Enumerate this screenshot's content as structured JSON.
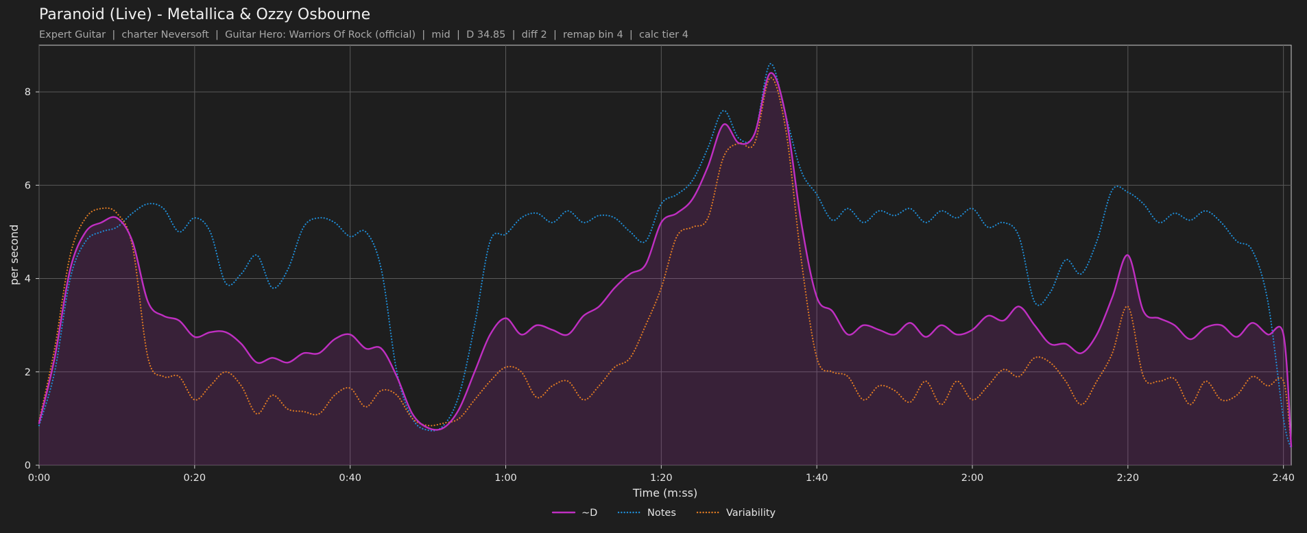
{
  "chart_data": {
    "type": "line",
    "title": "Paranoid (Live) - Metallica & Ozzy Osbourne",
    "subtitle": "Expert Guitar  |  charter Neversoft  |  Guitar Hero: Warriors Of Rock (official)  |  mid  |  D 34.85  |  diff 2  |  remap bin 4  |  calc tier 4",
    "xlabel": "Time (m:ss)",
    "ylabel": "per second",
    "xlim": [
      0,
      161
    ],
    "ylim": [
      0,
      9
    ],
    "grid": true,
    "legend_position": "bottom-center",
    "x_ticks": [
      0,
      20,
      40,
      60,
      80,
      100,
      120,
      140,
      160
    ],
    "x_tick_labels": [
      "0:00",
      "0:20",
      "0:40",
      "1:00",
      "1:20",
      "1:40",
      "2:00",
      "2:20",
      "2:40"
    ],
    "y_ticks": [
      0,
      2,
      4,
      6,
      8
    ],
    "y_tick_labels": [
      "0",
      "2",
      "4",
      "6",
      "8"
    ],
    "x": [
      0,
      2,
      4,
      6,
      8,
      10,
      12,
      14,
      16,
      18,
      20,
      22,
      24,
      26,
      28,
      30,
      32,
      34,
      36,
      38,
      40,
      42,
      44,
      46,
      48,
      50,
      52,
      54,
      56,
      58,
      60,
      62,
      64,
      66,
      68,
      70,
      72,
      74,
      76,
      78,
      80,
      82,
      84,
      86,
      88,
      90,
      92,
      94,
      96,
      98,
      100,
      102,
      104,
      106,
      108,
      110,
      112,
      114,
      116,
      118,
      120,
      122,
      124,
      126,
      128,
      130,
      132,
      134,
      136,
      138,
      140,
      142,
      144,
      146,
      148,
      150,
      152,
      154,
      156,
      158,
      160,
      161
    ],
    "series": [
      {
        "name": "~D",
        "color": "#c02fc2",
        "style": "solid",
        "fill": true,
        "values": [
          0.9,
          2.3,
          4.2,
          5.0,
          5.2,
          5.3,
          4.8,
          3.5,
          3.2,
          3.1,
          2.75,
          2.85,
          2.85,
          2.6,
          2.2,
          2.3,
          2.2,
          2.4,
          2.4,
          2.7,
          2.8,
          2.5,
          2.5,
          1.9,
          1.1,
          0.8,
          0.8,
          1.2,
          2.0,
          2.8,
          3.15,
          2.8,
          3.0,
          2.9,
          2.8,
          3.2,
          3.4,
          3.8,
          4.1,
          4.3,
          5.2,
          5.4,
          5.7,
          6.4,
          7.3,
          6.9,
          7.1,
          8.4,
          7.5,
          5.2,
          3.6,
          3.3,
          2.8,
          3.0,
          2.9,
          2.8,
          3.05,
          2.75,
          3.0,
          2.8,
          2.9,
          3.2,
          3.1,
          3.4,
          3.0,
          2.6,
          2.6,
          2.4,
          2.8,
          3.6,
          4.5,
          3.3,
          3.15,
          3.0,
          2.7,
          2.95,
          3.0,
          2.75,
          3.05,
          2.8,
          2.8,
          0.4
        ]
      },
      {
        "name": "Notes",
        "color": "#1f8dd6",
        "style": "dotted",
        "fill": false,
        "values": [
          0.85,
          2.0,
          4.0,
          4.8,
          5.0,
          5.1,
          5.4,
          5.6,
          5.5,
          5.0,
          5.3,
          5.0,
          3.9,
          4.1,
          4.5,
          3.8,
          4.2,
          5.1,
          5.3,
          5.2,
          4.9,
          5.0,
          4.2,
          2.0,
          1.0,
          0.75,
          0.85,
          1.5,
          3.0,
          4.8,
          4.95,
          5.3,
          5.4,
          5.2,
          5.45,
          5.2,
          5.35,
          5.3,
          5.0,
          4.8,
          5.6,
          5.8,
          6.1,
          6.8,
          7.6,
          7.0,
          7.1,
          8.6,
          7.5,
          6.3,
          5.8,
          5.25,
          5.5,
          5.2,
          5.45,
          5.35,
          5.5,
          5.2,
          5.45,
          5.3,
          5.5,
          5.1,
          5.2,
          4.9,
          3.5,
          3.7,
          4.4,
          4.1,
          4.8,
          5.9,
          5.85,
          5.6,
          5.2,
          5.4,
          5.25,
          5.45,
          5.2,
          4.8,
          4.6,
          3.5,
          1.0,
          0.35
        ]
      },
      {
        "name": "Variability",
        "color": "#e07b23",
        "style": "dotted",
        "fill": false,
        "values": [
          0.95,
          2.5,
          4.5,
          5.3,
          5.5,
          5.4,
          4.7,
          2.3,
          1.9,
          1.9,
          1.4,
          1.7,
          2.0,
          1.7,
          1.1,
          1.5,
          1.2,
          1.15,
          1.1,
          1.5,
          1.65,
          1.25,
          1.6,
          1.5,
          1.0,
          0.85,
          0.9,
          1.0,
          1.4,
          1.8,
          2.1,
          2.0,
          1.45,
          1.7,
          1.8,
          1.4,
          1.7,
          2.1,
          2.3,
          3.0,
          3.8,
          4.9,
          5.1,
          5.3,
          6.6,
          6.9,
          6.9,
          8.3,
          7.2,
          4.4,
          2.3,
          2.0,
          1.9,
          1.4,
          1.7,
          1.6,
          1.35,
          1.8,
          1.3,
          1.8,
          1.4,
          1.7,
          2.05,
          1.9,
          2.3,
          2.2,
          1.8,
          1.3,
          1.8,
          2.4,
          3.4,
          1.9,
          1.8,
          1.85,
          1.3,
          1.8,
          1.4,
          1.5,
          1.9,
          1.7,
          1.8,
          0.4
        ]
      }
    ]
  }
}
